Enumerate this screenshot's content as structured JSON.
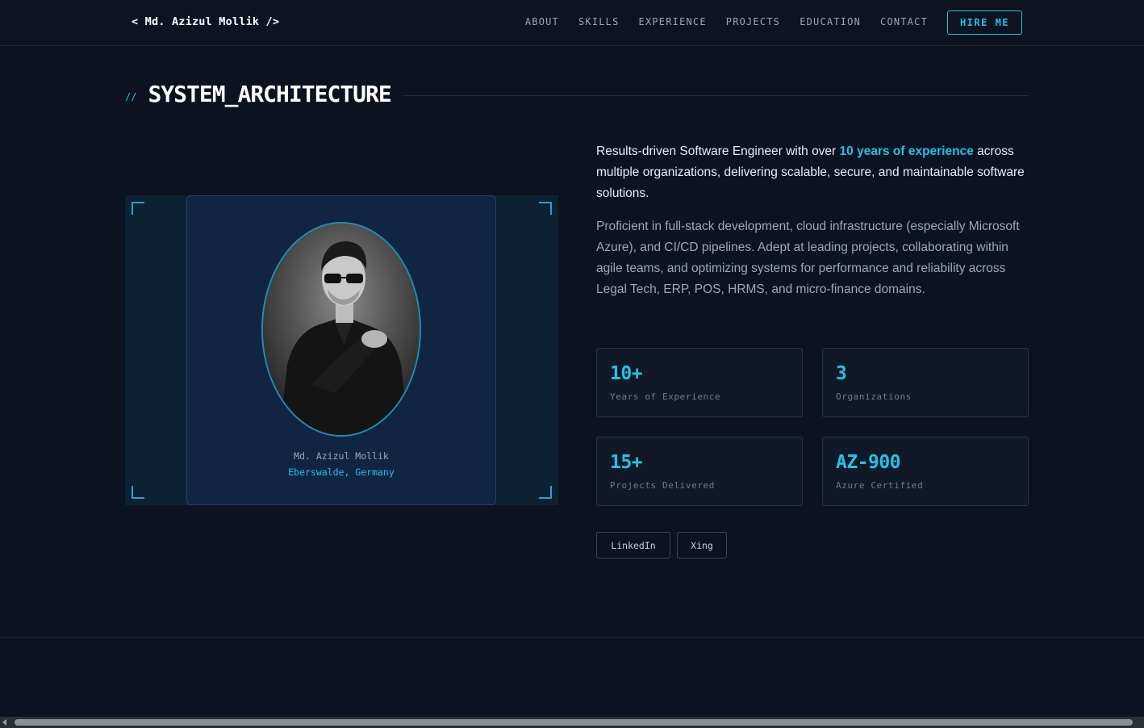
{
  "nav": {
    "logo": "< Md. Azizul Mollik />",
    "links": [
      "ABOUT",
      "SKILLS",
      "EXPERIENCE",
      "PROJECTS",
      "EDUCATION",
      "CONTACT"
    ],
    "hire_label": "HIRE ME"
  },
  "section": {
    "prefix": "//",
    "title": "SYSTEM_ARCHITECTURE"
  },
  "profile": {
    "name": "Md. Azizul Mollik",
    "location": "Eberswalde, Germany"
  },
  "bio": {
    "intro_before": "Results-driven Software Engineer with over ",
    "intro_highlight": "10 years of experience",
    "intro_after": " across multiple organizations, delivering scalable, secure, and maintainable software solutions.",
    "secondary": "Proficient in full-stack development, cloud infrastructure (especially Microsoft Azure), and CI/CD pipelines. Adept at leading projects, collaborating within agile teams, and optimizing systems for performance and reliability across Legal Tech, ERP, POS, HRMS, and micro-finance domains."
  },
  "stats": [
    {
      "value": "10+",
      "label": "Years of Experience"
    },
    {
      "value": "3",
      "label": "Organizations"
    },
    {
      "value": "15+",
      "label": "Projects Delivered"
    },
    {
      "value": "AZ-900",
      "label": "Azure Certified"
    }
  ],
  "social": {
    "linkedin": "LinkedIn",
    "xing": "Xing"
  },
  "colors": {
    "background": "#0c1220",
    "accent": "#22c3e6",
    "card": "#112542"
  }
}
